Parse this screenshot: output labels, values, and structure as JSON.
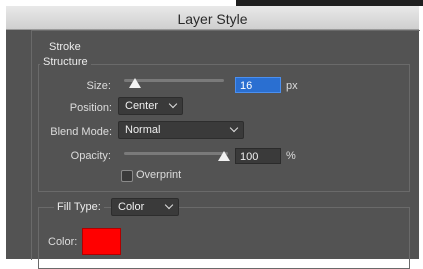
{
  "window": {
    "title": "Layer Style"
  },
  "stroke": {
    "section_label": "Stroke",
    "structure": {
      "label": "Structure",
      "size": {
        "label": "Size:",
        "value": "16",
        "unit": "px",
        "slider_fraction": 0.1
      },
      "position": {
        "label": "Position:",
        "value": "Center"
      },
      "blend_mode": {
        "label": "Blend Mode:",
        "value": "Normal"
      },
      "opacity": {
        "label": "Opacity:",
        "value": "100",
        "unit": "%",
        "slider_fraction": 1.0
      },
      "overprint": {
        "label": "Overprint",
        "checked": false
      }
    },
    "fill": {
      "fill_type_label": "Fill Type:",
      "fill_type_value": "Color",
      "color_label": "Color:",
      "color_value": "#ff0000"
    }
  }
}
